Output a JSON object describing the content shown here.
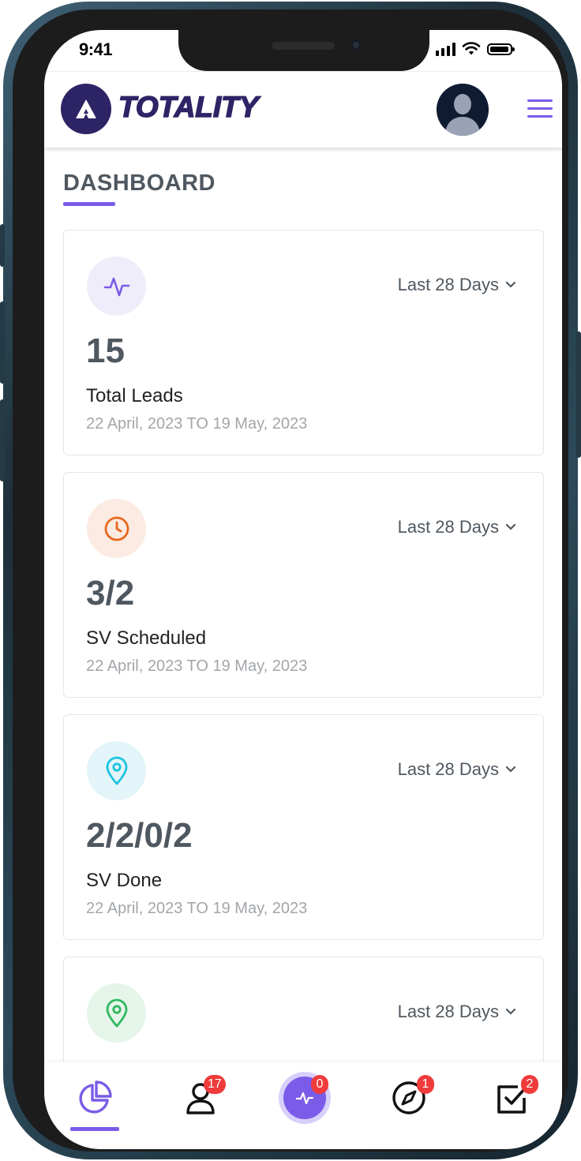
{
  "status_bar": {
    "time": "9:41"
  },
  "header": {
    "logo_text": "TOTALITY"
  },
  "page": {
    "title": "DASHBOARD"
  },
  "cards": [
    {
      "icon": "activity-icon",
      "range": "Last 28 Days",
      "value": "15",
      "label": "Total Leads",
      "dates": "22 April, 2023 TO 19 May, 2023",
      "accent": "#7a5ce8",
      "icon_bg": "#efedf9"
    },
    {
      "icon": "clock-icon",
      "range": "Last 28 Days",
      "value": "3/2",
      "label": "SV Scheduled",
      "dates": "22 April, 2023 TO 19 May, 2023",
      "accent": "#e8681c",
      "icon_bg": "#fbebe2"
    },
    {
      "icon": "map-pin-icon",
      "range": "Last 28 Days",
      "value": "2/2/0/2",
      "label": "SV Done",
      "dates": "22 April, 2023 TO 19 May, 2023",
      "accent": "#1ec4e0",
      "icon_bg": "#e3f5f8"
    },
    {
      "icon": "map-pin-icon",
      "range": "Last 28 Days",
      "value": "",
      "label": "",
      "dates": "",
      "accent": "#2fb95e",
      "icon_bg": "#e5f5ea"
    }
  ],
  "bottom_nav": {
    "items": [
      {
        "name": "dashboard",
        "icon": "pie-chart-icon",
        "badge": ""
      },
      {
        "name": "leads",
        "icon": "user-icon",
        "badge": "17"
      },
      {
        "name": "activity",
        "icon": "activity-icon",
        "badge": "0"
      },
      {
        "name": "explore",
        "icon": "compass-icon",
        "badge": "1"
      },
      {
        "name": "tasks",
        "icon": "checkbox-icon",
        "badge": "2"
      }
    ]
  },
  "colors": {
    "accent": "#7a5ce8",
    "brand": "#2d2466",
    "badge": "#ef3b3b"
  }
}
